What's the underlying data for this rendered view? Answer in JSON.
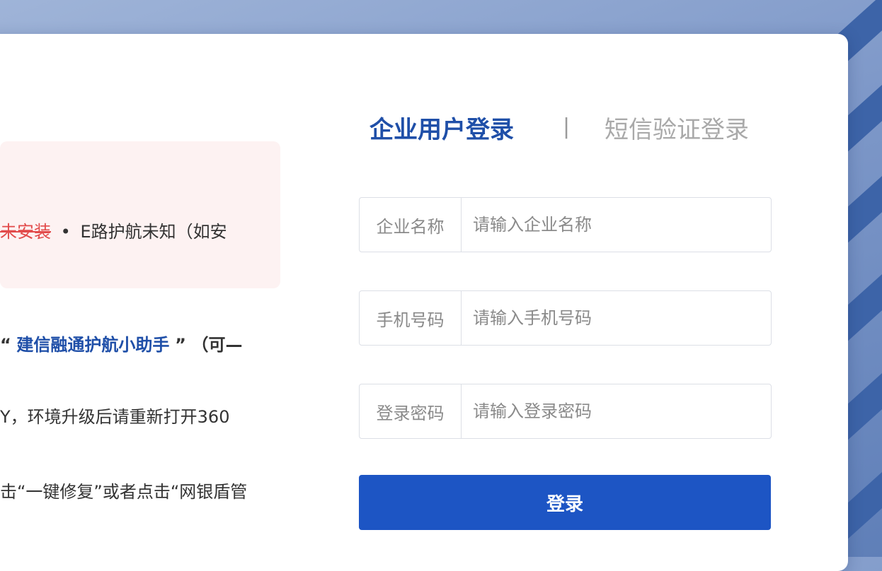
{
  "login": {
    "tabs": [
      {
        "label": "企业用户登录",
        "active": true
      },
      {
        "label": "短信验证登录",
        "active": false
      }
    ],
    "separator": "|",
    "fields": [
      {
        "label": "企业名称",
        "placeholder": "请输入企业名称"
      },
      {
        "label": "手机号码",
        "placeholder": "请输入手机号码"
      },
      {
        "label": "登录密码",
        "placeholder": "请输入登录密码"
      }
    ],
    "submit_label": "登录"
  },
  "notice": {
    "warn_text": "未安装",
    "dot": "•",
    "info_text": "E路护航未知（如安"
  },
  "tips": {
    "t1_quote_open": "“",
    "t1_highlight": "建信融通护航小助手",
    "t1_quote_close": "”",
    "t1_rest": "（可—",
    "t2": "Y，环境升级后请重新打开360",
    "t3": "击“一键修复”或者点击“网银盾管"
  },
  "colors": {
    "accent": "#1f4fa8",
    "button": "#1d55c4",
    "warning": "#e24b4b",
    "notice_bg": "#fdf2f2"
  }
}
